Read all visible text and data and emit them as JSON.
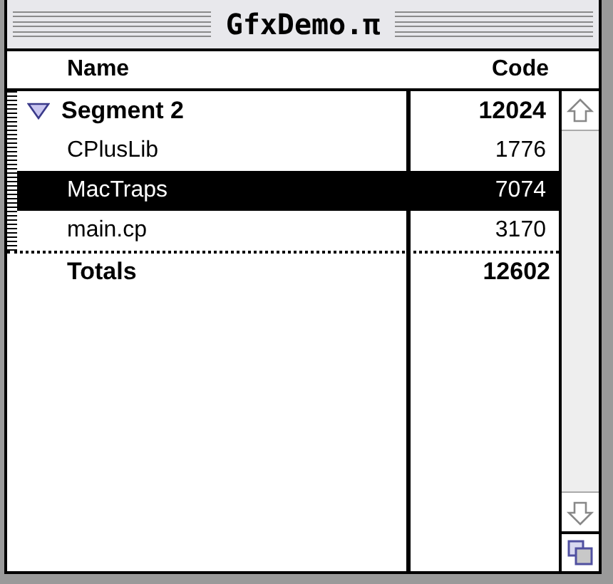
{
  "window": {
    "title": "GfxDemo.π"
  },
  "table": {
    "columns": [
      "Name",
      "Code"
    ],
    "segments": [
      {
        "name": "Segment 2",
        "code": "12024",
        "expanded": true,
        "children": [
          {
            "name": "CPlusLib",
            "code": "1776",
            "selected": false
          },
          {
            "name": "MacTraps",
            "code": "7074",
            "selected": true
          },
          {
            "name": "main.cp",
            "code": "3170",
            "selected": false
          }
        ]
      }
    ],
    "totals": {
      "label": "Totals",
      "code": "12602"
    }
  }
}
